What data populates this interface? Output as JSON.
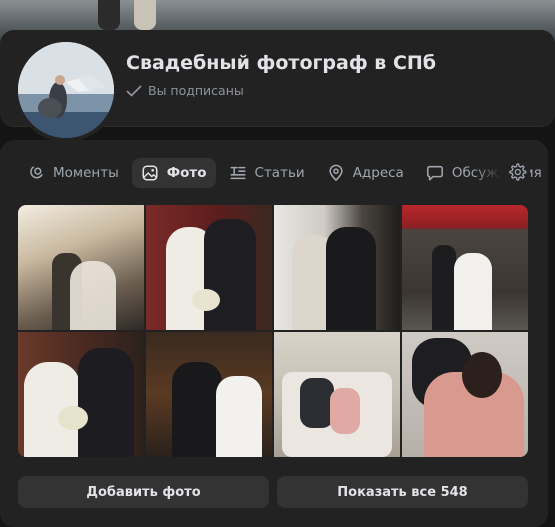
{
  "group": {
    "name": "Свадебный фотограф в СПб",
    "status": "Вы подписаны"
  },
  "tabs": [
    {
      "label": "Моменты",
      "icon": "moments-icon",
      "active": false
    },
    {
      "label": "Фото",
      "icon": "photo-icon",
      "active": true
    },
    {
      "label": "Статьи",
      "icon": "articles-icon",
      "active": false
    },
    {
      "label": "Адреса",
      "icon": "location-pin-icon",
      "active": false
    },
    {
      "label": "Обсуждения",
      "icon": "discussion-icon",
      "active": false
    }
  ],
  "actions": {
    "add_photo": "Добавить фото",
    "show_all": "Показать все 548"
  },
  "colors": {
    "background": "#141414",
    "card": "#222222",
    "button": "#333333",
    "text": "#e1e3e6",
    "muted": "#8d9399"
  }
}
